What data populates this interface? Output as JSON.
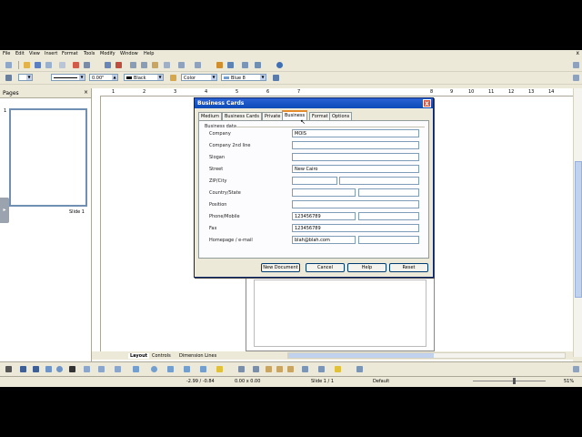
{
  "menubar": [
    "File",
    "Edit",
    "View",
    "Insert",
    "Format",
    "Tools",
    "Modify",
    "Window",
    "Help"
  ],
  "close_glyph": "x",
  "format_toolbar": {
    "line_width": "0.00\"",
    "line_color": "Black",
    "area_style": "Color",
    "area_color": "Blue 8"
  },
  "pages_pane": {
    "title": "Pages",
    "slide_number": "1",
    "slide_label": "Slide 1"
  },
  "ruler_numbers": [
    "1",
    "2",
    "3",
    "4",
    "5",
    "6",
    "7",
    "8",
    "9",
    "10",
    "11",
    "12",
    "13",
    "14"
  ],
  "bottom_tabs": [
    "Layout",
    "Controls",
    "Dimension Lines"
  ],
  "status": {
    "position": "-2.99 / -0.84",
    "size": "0.00 x 0.00",
    "slide": "Slide 1 / 1",
    "layout": "Default",
    "zoom": "51%"
  },
  "dialog": {
    "title": "Business Cards",
    "close_glyph": "X",
    "tabs": [
      {
        "label": "Medium",
        "active": false
      },
      {
        "label": "Business Cards",
        "active": false
      },
      {
        "label": "Private",
        "active": false
      },
      {
        "label": "Business",
        "active": true
      },
      {
        "label": "Format",
        "active": false
      },
      {
        "label": "Options",
        "active": false
      }
    ],
    "section": "Business data",
    "fields": {
      "company": {
        "label": "Company",
        "value": "MOIS"
      },
      "company2": {
        "label": "Company 2nd line",
        "value": ""
      },
      "slogan": {
        "label": "Slogan",
        "value": ""
      },
      "street": {
        "label": "Street",
        "value": "New Cairo"
      },
      "zipcity": {
        "label": "ZIP/City",
        "value": "",
        "value2": ""
      },
      "country": {
        "label": "Country/State",
        "value": "",
        "value2": ""
      },
      "position": {
        "label": "Position",
        "value": ""
      },
      "phone": {
        "label": "Phone/Mobile",
        "value": "123456789",
        "value2": ""
      },
      "fax": {
        "label": "Fax",
        "value": "123456789"
      },
      "homepage": {
        "label": "Homepage / e-mail",
        "value": "",
        "value2": "blah@blah.com"
      }
    },
    "buttons": {
      "new_document": "New Document",
      "cancel": "Cancel",
      "help": "Help",
      "reset": "Reset"
    }
  }
}
